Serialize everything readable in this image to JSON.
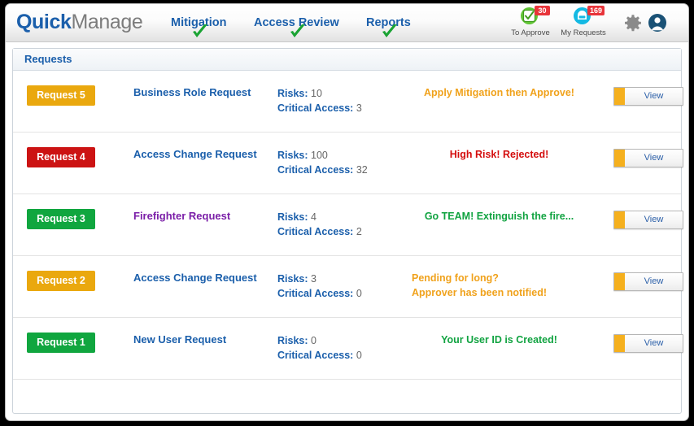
{
  "header": {
    "logo_bold": "Quick",
    "logo_light": "Manage",
    "nav": [
      {
        "label": "Mitigation",
        "icon": "check-tick-icon"
      },
      {
        "label": "Access Review",
        "icon": "check-tick-icon"
      },
      {
        "label": "Reports",
        "icon": "check-tick-icon"
      }
    ],
    "counters": [
      {
        "label": "To Approve",
        "count": "30",
        "icon": "approve-checkbox-icon",
        "color": "#61c436"
      },
      {
        "label": "My Requests",
        "count": "169",
        "icon": "inbox-tray-icon",
        "color": "#14b9e3"
      }
    ],
    "gear_icon": "gear-icon",
    "avatar_icon": "user-avatar-icon"
  },
  "panel": {
    "title": "Requests",
    "view_label": "View",
    "risks_label": "Risks:",
    "critical_label": "Critical Access:",
    "rows": [
      {
        "tag": "Request 5",
        "tag_color": "#eaa80e",
        "title": "Business Role Request",
        "title_color": "#1b5fab",
        "risks": "10",
        "critical": "3",
        "status": "Apply Mitigation then Approve!",
        "status_color": "#f0a21c",
        "status_align": "center",
        "view_strip_color": "#f5b01e"
      },
      {
        "tag": "Request 4",
        "tag_color": "#cc1313",
        "title": "Access Change Request",
        "title_color": "#1b5fab",
        "risks": "100",
        "critical": "32",
        "status": "High Risk! Rejected!",
        "status_color": "#d40d0d",
        "status_align": "center",
        "view_strip_color": "#f5b01e"
      },
      {
        "tag": "Request 3",
        "tag_color": "#10a63f",
        "title": "Firefighter Request",
        "title_color": "#7b1fa8",
        "risks": "4",
        "critical": "2",
        "status": "Go TEAM! Extinguish the fire...",
        "status_color": "#11a341",
        "status_align": "center",
        "view_strip_color": "#f5b01e"
      },
      {
        "tag": "Request 2",
        "tag_color": "#eaa80e",
        "title": "Access Change Request",
        "title_color": "#1b5fab",
        "risks": "3",
        "critical": "0",
        "status": "Pending for long?\nApprover has been notified!",
        "status_color": "#f0a21c",
        "status_align": "left",
        "view_strip_color": "#f5b01e"
      },
      {
        "tag": "Request 1",
        "tag_color": "#10a63f",
        "title": "New User Request",
        "title_color": "#1b5fab",
        "risks": "0",
        "critical": "0",
        "status": "Your User ID is Created!",
        "status_color": "#11a341",
        "status_align": "center",
        "view_strip_color": "#f5b01e"
      }
    ]
  }
}
